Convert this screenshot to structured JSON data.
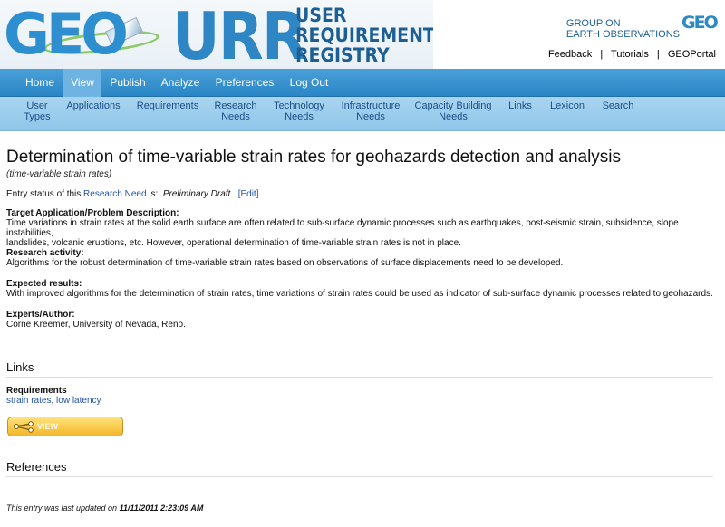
{
  "header": {
    "logo_geo_text": "GEO",
    "logo_urr_text": "URR",
    "logo_urr_subtitle": [
      "USER",
      "REQUIREMENTS",
      "REGISTRY"
    ],
    "group_brand_lines": [
      "GROUP ON",
      "EARTH OBSERVATIONS"
    ],
    "group_brand_logo": "GEO",
    "top_links": [
      "Feedback",
      "Tutorials",
      "GEOPortal"
    ]
  },
  "main_nav": [
    "Home",
    "View",
    "Publish",
    "Analyze",
    "Preferences",
    "Log Out"
  ],
  "main_nav_active": "View",
  "sub_nav": [
    [
      "User",
      "Types"
    ],
    [
      "Applications"
    ],
    [
      "Requirements"
    ],
    [
      "Research",
      "Needs"
    ],
    [
      "Technology",
      "Needs"
    ],
    [
      "Infrastructure",
      "Needs"
    ],
    [
      "Capacity Building",
      "Needs"
    ],
    [
      "Links"
    ],
    [
      "Lexicon"
    ],
    [
      "Search"
    ]
  ],
  "page": {
    "title": "Determination of time-variable strain rates for geohazards detection and analysis",
    "subtitle": "(time-variable strain rates)",
    "status_prefix": "Entry status of this",
    "status_link": "Research Need",
    "status_mid": "is:",
    "status_value": "Preliminary Draft",
    "status_edit": "[Edit]",
    "sections": [
      {
        "label": "Target Application/Problem Description:",
        "lines": [
          "Time variations in strain rates at the solid earth surface are often related to sub-surface dynamic processes such as earthquakes, post-seismic strain, subsidence, slope instabilities,",
          "landslides, volcanic eruptions, etc. However, operational determination of time-variable strain rates is not in place."
        ]
      },
      {
        "label": "Research activity:",
        "lines": [
          "Algorithms for the robust determination of time-variable strain rates based on observations of surface displacements need to be developed."
        ]
      },
      {
        "label": "Expected results:",
        "lines": [
          "With improved algorithms for the determination of strain rates, time variations of strain rates could be used as indicator of sub-surface dynamic processes related to geohazards."
        ]
      },
      {
        "label": "Experts/Author:",
        "lines": [
          "Corne Kreemer, University of Nevada, Reno."
        ]
      }
    ],
    "links_header": "Links",
    "requirements_label": "Requirements",
    "requirement_links": [
      "strain rates",
      "low latency"
    ],
    "view_relationships_button": "VIEW RELATIONSHIPS",
    "references_header": "References",
    "footer_prefix": "This entry was last updated on",
    "footer_date": "11/11/2011 2:23:09 AM"
  }
}
